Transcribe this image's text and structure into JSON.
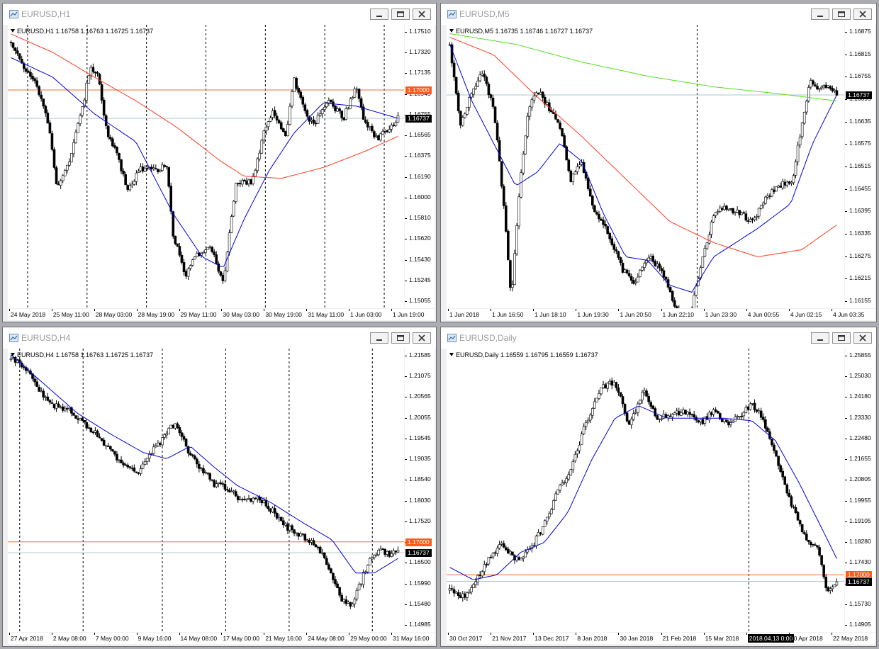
{
  "colors": {
    "bull": "#ffffff",
    "bear": "#000000",
    "ma_blue": "#0000dd",
    "ma_red": "#ff3b1f",
    "ma_green": "#55dd22",
    "level_line": "#ff6a2a",
    "bid_line": "#a9c7c7",
    "tag_level": "#ff5a1f",
    "tag_price": "#000000"
  },
  "windows": [
    {
      "id": "h1",
      "title": "EURUSD,H1",
      "info": "EURUSD,H1  1.16758 1.16763 1.16725 1.16737",
      "y_range": [
        1.14975,
        1.17605
      ],
      "y_ticks": [
        "1.17510",
        "1.17320",
        "1.17135",
        "1.16945",
        "1.16755",
        "1.16565",
        "1.16375",
        "1.16190",
        "1.16000",
        "1.15810",
        "1.15620",
        "1.15430",
        "1.15245",
        "1.15055"
      ],
      "x_ticks": [
        "24 May 2018",
        "25 May 11:00",
        "28 May 03:00",
        "28 May 19:00",
        "29 May 11:00",
        "30 May 03:00",
        "30 May 19:00",
        "31 May 11:00",
        "1 Jun 03:00",
        "1 Jun 19:00"
      ],
      "x_highlight": null,
      "level": "1.17000",
      "price": "1.16737",
      "path": [
        [
          0,
          1.1745
        ],
        [
          6,
          1.1722
        ],
        [
          12,
          1.1706
        ],
        [
          18,
          1.167
        ],
        [
          22,
          1.1608
        ],
        [
          28,
          1.1635
        ],
        [
          34,
          1.168
        ],
        [
          38,
          1.172
        ],
        [
          42,
          1.1712
        ],
        [
          46,
          1.1662
        ],
        [
          52,
          1.1635
        ],
        [
          56,
          1.1605
        ],
        [
          62,
          1.1628
        ],
        [
          70,
          1.1625
        ],
        [
          75,
          1.163
        ],
        [
          78,
          1.1565
        ],
        [
          84,
          1.1528
        ],
        [
          88,
          1.1545
        ],
        [
          96,
          1.1555
        ],
        [
          102,
          1.152
        ],
        [
          108,
          1.1612
        ],
        [
          116,
          1.1615
        ],
        [
          122,
          1.1665
        ],
        [
          126,
          1.1682
        ],
        [
          132,
          1.1655
        ],
        [
          136,
          1.171
        ],
        [
          142,
          1.1675
        ],
        [
          146,
          1.167
        ],
        [
          152,
          1.169
        ],
        [
          160,
          1.1675
        ],
        [
          166,
          1.1705
        ],
        [
          170,
          1.167
        ],
        [
          176,
          1.1655
        ],
        [
          182,
          1.1665
        ],
        [
          186,
          1.16737
        ]
      ],
      "mas": [
        {
          "color": "ma_blue",
          "pts": [
            [
              0,
              1.173
            ],
            [
              20,
              1.1712
            ],
            [
              40,
              1.1678
            ],
            [
              60,
              1.1652
            ],
            [
              78,
              1.1585
            ],
            [
              92,
              1.1545
            ],
            [
              102,
              1.1535
            ],
            [
              112,
              1.158
            ],
            [
              124,
              1.1625
            ],
            [
              136,
              1.166
            ],
            [
              150,
              1.1688
            ],
            [
              166,
              1.1685
            ],
            [
              186,
              1.16737
            ]
          ]
        },
        {
          "color": "ma_red",
          "pts": [
            [
              0,
              1.1752
            ],
            [
              20,
              1.1735
            ],
            [
              40,
              1.1712
            ],
            [
              60,
              1.169
            ],
            [
              80,
              1.1665
            ],
            [
              100,
              1.1635
            ],
            [
              112,
              1.162
            ],
            [
              130,
              1.1618
            ],
            [
              150,
              1.1628
            ],
            [
              170,
              1.1643
            ],
            [
              186,
              1.1657
            ]
          ]
        }
      ],
      "vlines": [
        0.05,
        0.2,
        0.35,
        0.5,
        0.65,
        0.8,
        0.95
      ]
    },
    {
      "id": "m5",
      "title": "EURUSD,M5",
      "info": "EURUSD,M5  1.16735 1.16746 1.16727 1.16737",
      "y_range": [
        1.16135,
        1.16935
      ],
      "y_ticks": [
        "1.16875",
        "1.16815",
        "1.16755",
        "1.16695",
        "1.16635",
        "1.16575",
        "1.16515",
        "1.16455",
        "1.16395",
        "1.16335",
        "1.16275",
        "1.16215",
        "1.16155"
      ],
      "x_ticks": [
        "1 Jun 2018",
        "1 Jun 16:50",
        "1 Jun 18:10",
        "1 Jun 19:30",
        "1 Jun 20:50",
        "1 Jun 22:10",
        "1 Jun 23:30",
        "4 Jun 00:55",
        "4 Jun 02:15",
        "4 Jun 03:35"
      ],
      "x_highlight": null,
      "level": null,
      "price": "1.16737",
      "path": [
        [
          0,
          1.1688
        ],
        [
          5,
          1.1665
        ],
        [
          10,
          1.1675
        ],
        [
          15,
          1.168
        ],
        [
          20,
          1.167
        ],
        [
          25,
          1.164
        ],
        [
          28,
          1.1615
        ],
        [
          32,
          1.165
        ],
        [
          36,
          1.167
        ],
        [
          40,
          1.1675
        ],
        [
          45,
          1.167
        ],
        [
          50,
          1.1665
        ],
        [
          55,
          1.165
        ],
        [
          60,
          1.1655
        ],
        [
          66,
          1.164
        ],
        [
          72,
          1.1635
        ],
        [
          78,
          1.1625
        ],
        [
          84,
          1.162
        ],
        [
          90,
          1.1628
        ],
        [
          96,
          1.1625
        ],
        [
          102,
          1.1615
        ],
        [
          108,
          1.1608
        ],
        [
          114,
          1.1625
        ],
        [
          120,
          1.164
        ],
        [
          126,
          1.1642
        ],
        [
          132,
          1.164
        ],
        [
          138,
          1.1638
        ],
        [
          144,
          1.1645
        ],
        [
          150,
          1.1648
        ],
        [
          156,
          1.165
        ],
        [
          160,
          1.1665
        ],
        [
          164,
          1.1678
        ],
        [
          168,
          1.1675
        ],
        [
          172,
          1.1676
        ],
        [
          176,
          1.16737
        ]
      ],
      "mas": [
        {
          "color": "ma_blue",
          "pts": [
            [
              0,
              1.1688
            ],
            [
              10,
              1.1672
            ],
            [
              20,
              1.166
            ],
            [
              30,
              1.1648
            ],
            [
              40,
              1.1652
            ],
            [
              50,
              1.166
            ],
            [
              60,
              1.1655
            ],
            [
              70,
              1.164
            ],
            [
              80,
              1.1628
            ],
            [
              90,
              1.1627
            ],
            [
              100,
              1.162
            ],
            [
              110,
              1.1618
            ],
            [
              120,
              1.1628
            ],
            [
              140,
              1.1636
            ],
            [
              155,
              1.1643
            ],
            [
              165,
              1.166
            ],
            [
              176,
              1.16737
            ]
          ]
        },
        {
          "color": "ma_red",
          "pts": [
            [
              0,
              1.169
            ],
            [
              20,
              1.1685
            ],
            [
              40,
              1.1673
            ],
            [
              60,
              1.1662
            ],
            [
              80,
              1.165
            ],
            [
              100,
              1.1638
            ],
            [
              120,
              1.1632
            ],
            [
              140,
              1.1628
            ],
            [
              160,
              1.163
            ],
            [
              176,
              1.1637
            ]
          ]
        },
        {
          "color": "ma_green",
          "pts": [
            [
              0,
              1.1691
            ],
            [
              30,
              1.1688
            ],
            [
              60,
              1.1683
            ],
            [
              90,
              1.1679
            ],
            [
              120,
              1.1676
            ],
            [
              150,
              1.1674
            ],
            [
              176,
              1.1672
            ]
          ]
        }
      ],
      "vlines": [
        0.63
      ]
    },
    {
      "id": "h4",
      "title": "EURUSD,H4",
      "info": "EURUSD,H4  1.16758 1.16763 1.16725 1.16737",
      "y_range": [
        1.1483,
        1.2165
      ],
      "y_ticks": [
        "1.21585",
        "1.21075",
        "1.20565",
        "1.20055",
        "1.19545",
        "1.19035",
        "1.18540",
        "1.18030",
        "1.17520",
        "1.17010",
        "1.16500",
        "1.15990",
        "1.15480",
        "1.14985"
      ],
      "x_ticks": [
        "27 Apr 2018",
        "2 May 08:00",
        "7 May 00:00",
        "9 May 16:00",
        "14 May 08:00",
        "17 May 00:00",
        "21 May 16:00",
        "24 May 08:00",
        "29 May 00:00",
        "31 May 16:00"
      ],
      "x_highlight": null,
      "level": "1.17000",
      "price": "1.16737",
      "path": [
        [
          0,
          1.214
        ],
        [
          6,
          1.212
        ],
        [
          12,
          1.206
        ],
        [
          18,
          1.203
        ],
        [
          24,
          1.202
        ],
        [
          30,
          1.199
        ],
        [
          36,
          1.196
        ],
        [
          42,
          1.192
        ],
        [
          48,
          1.188
        ],
        [
          54,
          1.187
        ],
        [
          60,
          1.192
        ],
        [
          66,
          1.196
        ],
        [
          70,
          1.199
        ],
        [
          74,
          1.193
        ],
        [
          80,
          1.188
        ],
        [
          86,
          1.184
        ],
        [
          92,
          1.183
        ],
        [
          98,
          1.1795
        ],
        [
          104,
          1.181
        ],
        [
          110,
          1.178
        ],
        [
          116,
          1.174
        ],
        [
          122,
          1.1715
        ],
        [
          128,
          1.17
        ],
        [
          134,
          1.165
        ],
        [
          140,
          1.156
        ],
        [
          144,
          1.1545
        ],
        [
          148,
          1.16
        ],
        [
          152,
          1.166
        ],
        [
          156,
          1.168
        ],
        [
          160,
          1.167
        ],
        [
          164,
          1.16737
        ]
      ],
      "mas": [
        {
          "color": "ma_blue",
          "pts": [
            [
              0,
              1.215
            ],
            [
              14,
              1.208
            ],
            [
              28,
              1.201
            ],
            [
              42,
              1.196
            ],
            [
              56,
              1.1915
            ],
            [
              66,
              1.19
            ],
            [
              76,
              1.193
            ],
            [
              86,
              1.188
            ],
            [
              96,
              1.1835
            ],
            [
              110,
              1.1795
            ],
            [
              124,
              1.1745
            ],
            [
              136,
              1.1705
            ],
            [
              146,
              1.1625
            ],
            [
              154,
              1.1625
            ],
            [
              164,
              1.166
            ]
          ]
        }
      ],
      "vlines": [
        0.03,
        0.19,
        0.39,
        0.55,
        0.71,
        0.92
      ]
    },
    {
      "id": "daily",
      "title": "EURUSD,Daily",
      "info": "EURUSD,Daily  1.16559 1.16795 1.16559 1.16737",
      "y_range": [
        1.147,
        1.261
      ],
      "y_ticks": [
        "1.25855",
        "1.25030",
        "1.24180",
        "1.23330",
        "1.22480",
        "1.21655",
        "1.20805",
        "1.19955",
        "1.19105",
        "1.18280",
        "1.17430",
        "1.16580",
        "1.15730",
        "1.14905"
      ],
      "x_ticks": [
        "30 Oct 2017",
        "21 Nov 2017",
        "13 Dec 2017",
        "8 Jan 2018",
        "30 Jan 2018",
        "21 Feb 2018",
        "15 Mar 2018",
        "2018.04.13 0:00",
        "30 Apr 2018",
        "22 May 2018"
      ],
      "x_highlight": "2018.04.13 0:00",
      "level": "1.17000",
      "price": "1.16737",
      "path": [
        [
          0,
          1.164
        ],
        [
          6,
          1.161
        ],
        [
          10,
          1.166
        ],
        [
          16,
          1.176
        ],
        [
          22,
          1.182
        ],
        [
          28,
          1.176
        ],
        [
          34,
          1.18
        ],
        [
          40,
          1.19
        ],
        [
          46,
          1.204
        ],
        [
          52,
          1.214
        ],
        [
          58,
          1.232
        ],
        [
          64,
          1.245
        ],
        [
          70,
          1.248
        ],
        [
          76,
          1.23
        ],
        [
          82,
          1.244
        ],
        [
          88,
          1.233
        ],
        [
          94,
          1.234
        ],
        [
          100,
          1.236
        ],
        [
          106,
          1.231
        ],
        [
          112,
          1.236
        ],
        [
          118,
          1.23
        ],
        [
          124,
          1.235
        ],
        [
          128,
          1.239
        ],
        [
          132,
          1.234
        ],
        [
          138,
          1.218
        ],
        [
          144,
          1.2
        ],
        [
          150,
          1.186
        ],
        [
          156,
          1.18
        ],
        [
          160,
          1.163
        ],
        [
          164,
          1.16737
        ]
      ],
      "mas": [
        {
          "color": "ma_blue",
          "pts": [
            [
              0,
              1.173
            ],
            [
              10,
              1.168
            ],
            [
              20,
              1.17
            ],
            [
              30,
              1.179
            ],
            [
              40,
              1.183
            ],
            [
              50,
              1.195
            ],
            [
              60,
              1.216
            ],
            [
              70,
              1.233
            ],
            [
              80,
              1.238
            ],
            [
              92,
              1.233
            ],
            [
              104,
              1.233
            ],
            [
              116,
              1.233
            ],
            [
              128,
              1.232
            ],
            [
              138,
              1.224
            ],
            [
              148,
              1.207
            ],
            [
              158,
              1.188
            ],
            [
              164,
              1.1765
            ]
          ]
        }
      ],
      "vlines": [
        0.76
      ]
    }
  ]
}
